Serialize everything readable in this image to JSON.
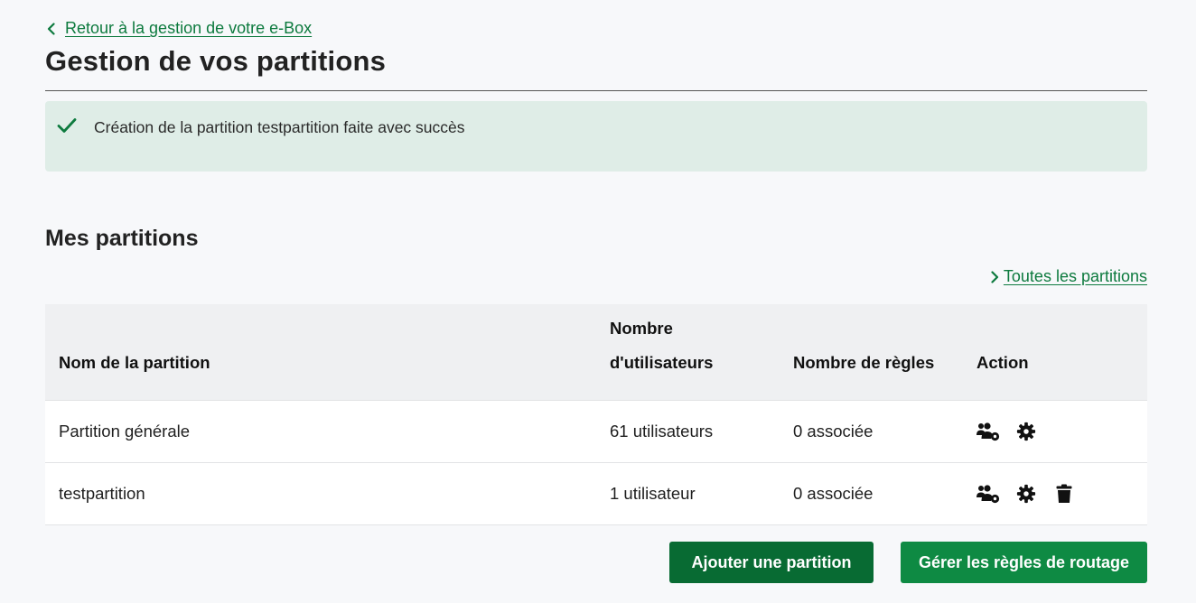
{
  "back_link": {
    "label": "Retour à la gestion de votre e-Box"
  },
  "page_title": "Gestion de vos partitions",
  "success": {
    "message": "Création de la partition testpartition faite avec succès"
  },
  "section_title": "Mes partitions",
  "all_partitions_link": {
    "label": "Toutes les partitions"
  },
  "table": {
    "headers": {
      "name": "Nom de la partition",
      "users_line1": "Nombre",
      "users_line2": "d'utilisateurs",
      "rules": "Nombre de règles",
      "action": "Action"
    },
    "rows": [
      {
        "name": "Partition générale",
        "users": "61 utilisateurs",
        "rules": "0 associée",
        "icons": [
          "manage-users-icon",
          "gear-icon"
        ]
      },
      {
        "name": "testpartition",
        "users": "1 utilisateur",
        "rules": "0 associée",
        "icons": [
          "manage-users-icon",
          "gear-icon",
          "trash-icon"
        ]
      }
    ]
  },
  "buttons": {
    "add_partition": "Ajouter une partition",
    "manage_routing": "Gérer les règles de routage"
  },
  "colors": {
    "accent_green": "#0d7a3e",
    "success_bg": "#dfede7",
    "button_dark": "#086b33",
    "button_light": "#0e8a43"
  }
}
